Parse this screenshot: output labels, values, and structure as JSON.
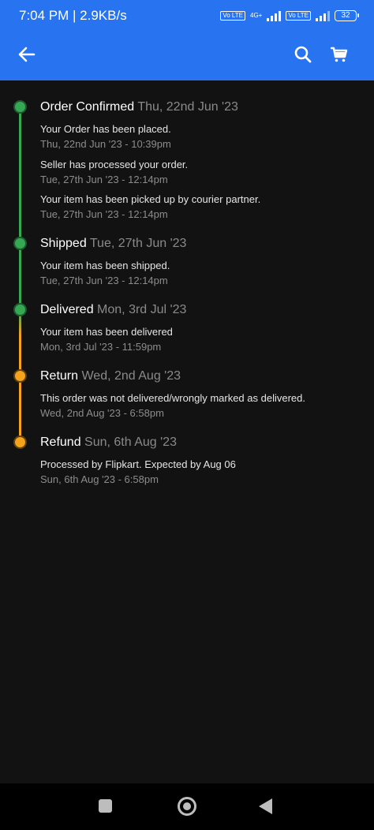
{
  "status_bar": {
    "time_speed": "7:04 PM | 2.9KB/s",
    "network_label": "4G+",
    "volte_label": "Vo LTE",
    "battery": "32"
  },
  "app_bar": {
    "back_icon": "arrow-left-icon",
    "search_icon": "search-icon",
    "cart_icon": "cart-icon",
    "color": "#2874f0"
  },
  "colors": {
    "delivered_green": "#34a853",
    "return_orange": "#f7a21b"
  },
  "timeline": [
    {
      "status": "Order Confirmed",
      "date": "Thu, 22nd Jun '23",
      "color": "green",
      "events": [
        {
          "message": "Your Order has been placed.",
          "time": "Thu, 22nd Jun '23 - 10:39pm"
        },
        {
          "message": "Seller has processed your order.",
          "time": "Tue, 27th Jun '23 - 12:14pm"
        },
        {
          "message": "Your item has been picked up by courier partner.",
          "time": "Tue, 27th Jun '23 - 12:14pm"
        }
      ]
    },
    {
      "status": "Shipped",
      "date": "Tue, 27th Jun '23",
      "color": "green",
      "events": [
        {
          "message": "Your item has been shipped.",
          "time": "Tue, 27th Jun '23 - 12:14pm"
        }
      ]
    },
    {
      "status": "Delivered",
      "date": "Mon, 3rd Jul '23",
      "color": "green",
      "events": [
        {
          "message": "Your item has been delivered",
          "time": "Mon, 3rd Jul '23 - 11:59pm"
        }
      ]
    },
    {
      "status": "Return",
      "date": "Wed, 2nd Aug '23",
      "color": "orange",
      "events": [
        {
          "message": "This order was not delivered/wrongly marked as delivered.",
          "time": "Wed, 2nd Aug '23 - 6:58pm"
        }
      ]
    },
    {
      "status": "Refund",
      "date": "Sun, 6th Aug '23",
      "color": "orange",
      "events": [
        {
          "message": "Processed by Flipkart. Expected by Aug 06",
          "time": "Sun, 6th Aug '23 - 6:58pm"
        }
      ]
    }
  ],
  "nav_bar": {
    "recents_icon": "square-icon",
    "home_icon": "circle-icon",
    "back_icon": "triangle-back-icon"
  }
}
